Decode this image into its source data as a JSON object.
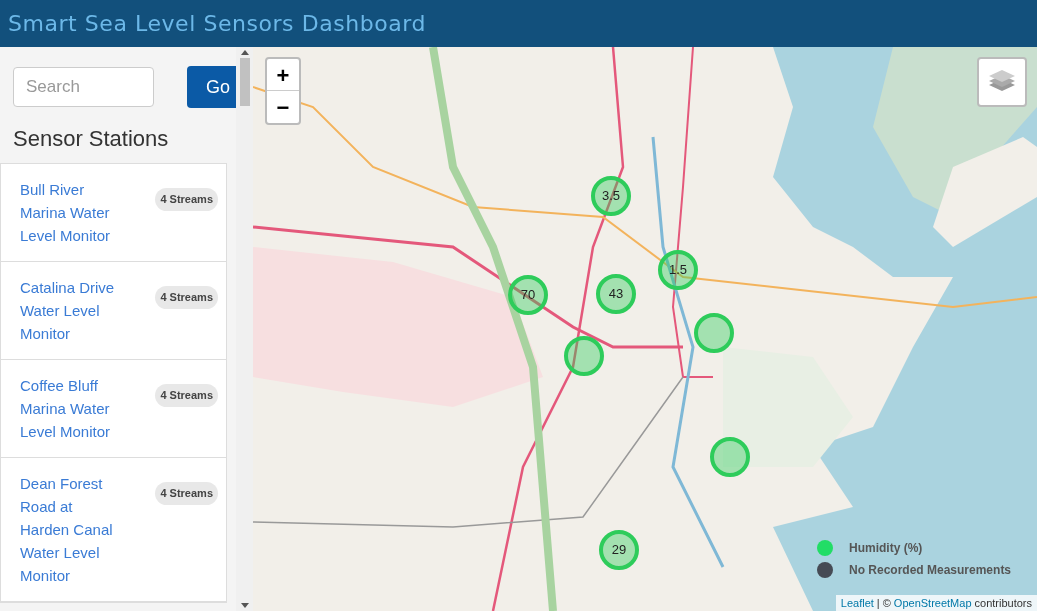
{
  "header": {
    "title": "Smart Sea Level Sensors Dashboard"
  },
  "sidebar": {
    "search": {
      "placeholder": "Search"
    },
    "go_button": "Go",
    "heading": "Sensor Stations",
    "stations": [
      {
        "name": "Bull River Marina Water Level Monitor",
        "badge": "4 Streams"
      },
      {
        "name": "Catalina Drive Water Level Monitor",
        "badge": "4 Streams"
      },
      {
        "name": "Coffee Bluff Marina Water Level Monitor",
        "badge": "4 Streams"
      },
      {
        "name": "Dean Forest Road at Harden Canal Water Level Monitor",
        "badge": "4 Streams"
      }
    ]
  },
  "map": {
    "zoom_in": "+",
    "zoom_out": "−",
    "markers": [
      {
        "label": "3.5",
        "color": "#2ecc5b"
      },
      {
        "label": "1.5",
        "color": "#2ecc5b"
      },
      {
        "label": "70",
        "color": "#2ecc5b"
      },
      {
        "label": "43",
        "color": "#2ecc5b"
      },
      {
        "color": "#2ecc5b"
      },
      {
        "color": "#2ecc5b"
      },
      {
        "color": "#2ecc5b"
      },
      {
        "label": "29",
        "color": "#2ecc5b"
      }
    ],
    "legend": [
      {
        "label": "Humidity (%)",
        "color": "#22dd66"
      },
      {
        "label": "No Recorded Measurements",
        "color": "#464b55"
      }
    ],
    "attribution": {
      "leaflet": "Leaflet",
      "separator": "| ©",
      "osm": "OpenStreetMap",
      "suffix": "contributors"
    }
  }
}
